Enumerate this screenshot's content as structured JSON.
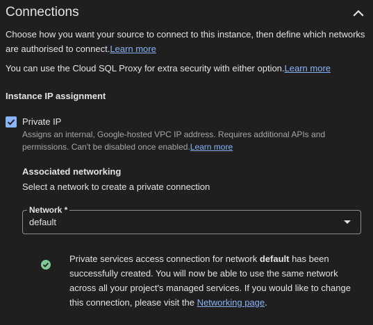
{
  "section": {
    "title": "Connections",
    "collapse_icon": "chevron-up-icon"
  },
  "intro": {
    "text": "Choose how you want your source to connect to this instance, then define which networks are authorised to connect.",
    "link": "Learn more"
  },
  "proxy": {
    "text": "You can use the Cloud SQL Proxy for extra security with either option.",
    "link": "Learn more"
  },
  "ip_assignment": {
    "heading": "Instance IP assignment",
    "private_ip": {
      "label": "Private IP",
      "checked": true,
      "description": "Assigns an internal, Google-hosted VPC IP address. Requires additional APIs and permissions. Can't be disabled once enabled.",
      "link": "Learn more"
    }
  },
  "networking": {
    "heading": "Associated networking",
    "subtext": "Select a network to create a private connection",
    "network_field": {
      "label": "Network *",
      "value": "default"
    }
  },
  "status": {
    "icon": "check-circle-icon",
    "color": "#81c995",
    "text_before": "Private services access connection for network ",
    "network_name": "default",
    "text_after": " has been successfully created. You will now be able to use the same network across all your project's managed services. If you would like to change this connection, please visit the ",
    "link": "Networking page",
    "text_end": "."
  },
  "colors": {
    "background": "#1f1f1f",
    "link": "#8ab4f8",
    "accent": "#8ab4f8"
  }
}
